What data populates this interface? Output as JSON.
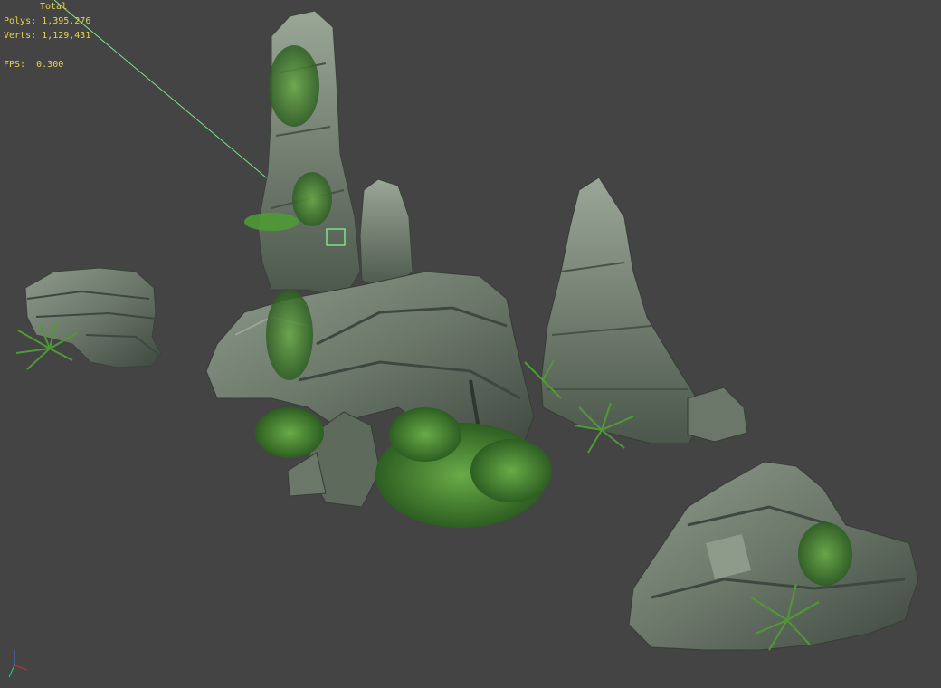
{
  "stats": {
    "title": "Total",
    "polys_label": "Polys:",
    "polys_value": "1,395,276",
    "verts_label": "Verts:",
    "verts_value": "1,129,431",
    "fps_label": "FPS:",
    "fps_value": "0.300"
  },
  "colors": {
    "background": "#444444",
    "stats_text": "#e6d54a",
    "selection_line": "#7fe08a",
    "rock": "#6d7a6b",
    "rock_dark": "#404a41",
    "rock_light": "#97a393",
    "foliage": "#3f7a2c",
    "foliage_light": "#6aab47"
  },
  "gizmo": {
    "axes": [
      "x",
      "y",
      "z"
    ]
  }
}
